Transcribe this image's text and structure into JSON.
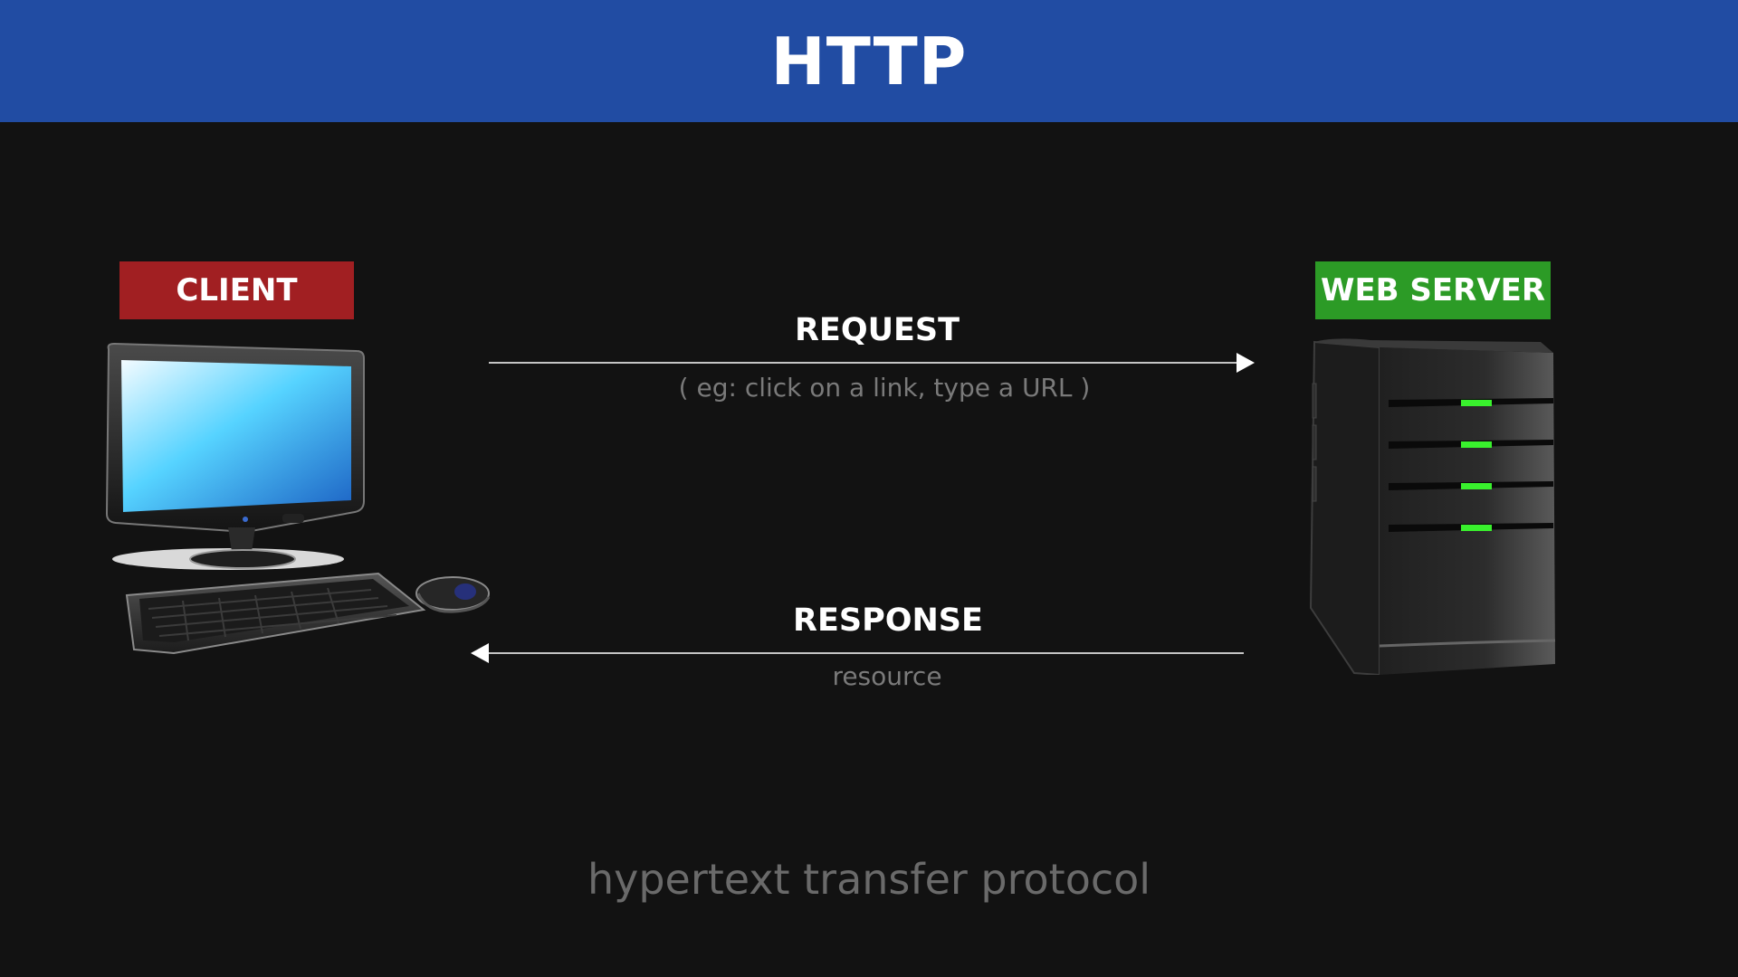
{
  "header": {
    "title": "HTTP"
  },
  "client": {
    "label": "CLIENT"
  },
  "server": {
    "label": "WEB SERVER"
  },
  "request": {
    "label": "REQUEST",
    "subtitle": "( eg: click on a link, type a URL )"
  },
  "response": {
    "label": "RESPONSE",
    "subtitle": "resource"
  },
  "footer": {
    "text": "hypertext transfer protocol"
  },
  "colors": {
    "background": "#121212",
    "header": "#214ca3",
    "client_tag": "#a11f22",
    "server_tag": "#2c9b26",
    "server_led": "#39f12d",
    "arrow": "#ffffff"
  },
  "icons": {
    "client": "desktop-computer-icon",
    "server": "server-tower-icon"
  }
}
